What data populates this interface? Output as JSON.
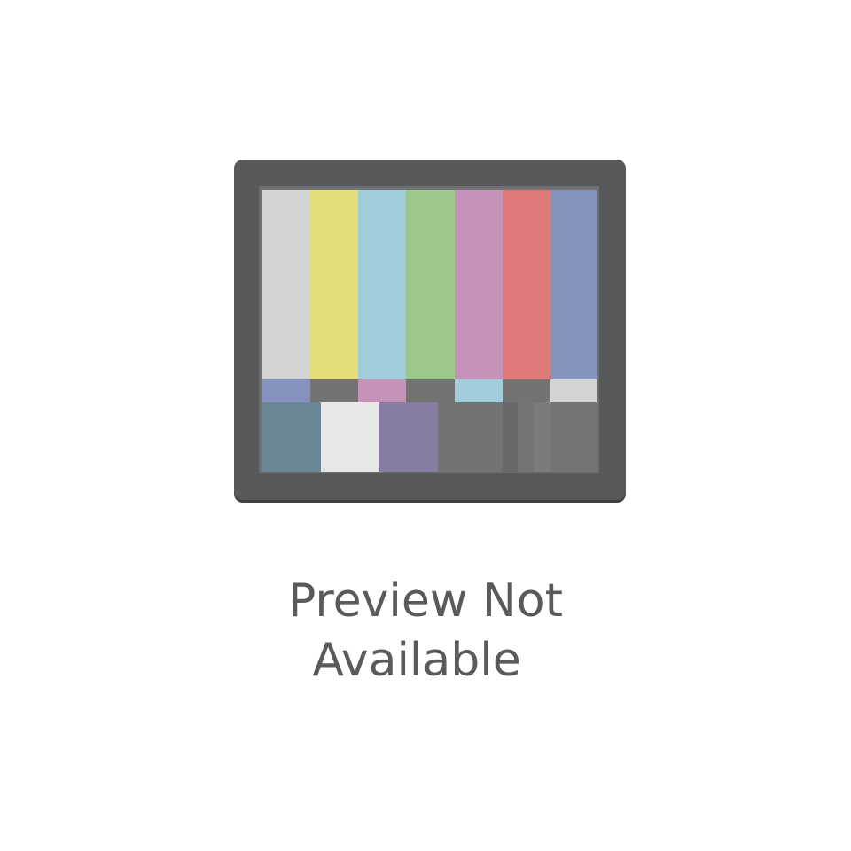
{
  "message": {
    "line1": "Preview Not",
    "line2": "Available"
  },
  "icon": "tv-color-bars-icon",
  "colors": {
    "frame": "#58595b",
    "text": "#5a5a5a",
    "top_bars": [
      "#d2d3d5",
      "#e3de77",
      "#a0cdd9",
      "#9cc78b",
      "#c692b8",
      "#de7879",
      "#8592bd"
    ],
    "middle_bars": [
      "#8592bd",
      "#727372",
      "#c692b8",
      "#727372",
      "#a0cdd9",
      "#727372",
      "#d2d3d5"
    ],
    "bottom_bars": [
      "#6b8795",
      "#e7e8e8",
      "#897ca4",
      "#727372",
      "#676869",
      "#737473",
      "#7a7b7c",
      "#737473"
    ]
  }
}
